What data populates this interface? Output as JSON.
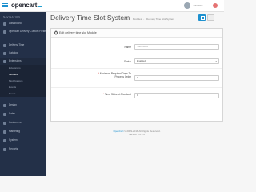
{
  "header": {
    "logo": "opencart",
    "username": "John Doe"
  },
  "sidebar": {
    "heading": "NAVIGATION",
    "items": [
      {
        "label": "Dashboard",
        "icon": "dashboard-icon"
      },
      {
        "label": "Opencart Delivery Custom Fields",
        "icon": "puzzle-icon"
      },
      {
        "label": "Delivery Time",
        "icon": "clock-icon"
      },
      {
        "label": "Catalog",
        "icon": "tag-icon"
      },
      {
        "label": "Extensions",
        "icon": "puzzle-icon"
      }
    ],
    "subitems": [
      "Extensions",
      "Modules",
      "Modifications",
      "Events",
      "Feeds"
    ],
    "items_bottom": [
      {
        "label": "Design",
        "icon": "desktop-icon"
      },
      {
        "label": "Sales",
        "icon": "cart-icon"
      },
      {
        "label": "Customers",
        "icon": "user-icon"
      },
      {
        "label": "Marketing",
        "icon": "share-icon"
      },
      {
        "label": "System",
        "icon": "gear-icon"
      },
      {
        "label": "Reports",
        "icon": "bar-chart-icon"
      }
    ]
  },
  "page": {
    "title": "Delivery Time Slot System",
    "breadcrumb": [
      "Home",
      "Modules",
      "Delivery Time Slot System"
    ]
  },
  "panel": {
    "heading": "Edit delivery time slot Module",
    "fields": [
      {
        "label": "Name",
        "required": false,
        "value": "",
        "placeholder": "Your Store"
      },
      {
        "label": "Status",
        "required": false,
        "value": "Enabled",
        "type": "select"
      },
      {
        "label": "Minimum Required Days To Process Order",
        "required": true,
        "value": "0"
      },
      {
        "label": "Time Slots At Checkout",
        "required": true,
        "value": "1"
      }
    ]
  },
  "footer": {
    "brand": "OpenCart",
    "copyright": "© 2009-2018 All Rights Reserved.",
    "version": "Version 3.0.2.0"
  },
  "colors": {
    "accent": "#1e91cf",
    "sidebar": "#233048",
    "required": "#d9534f"
  }
}
